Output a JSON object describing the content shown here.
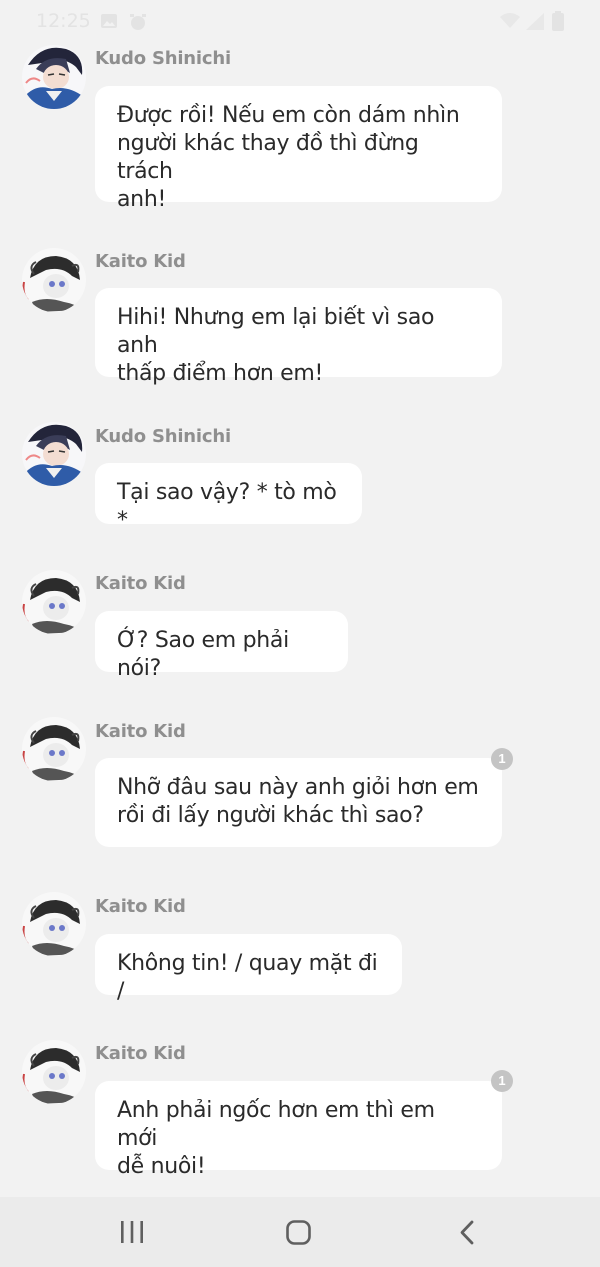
{
  "status_bar": {
    "time": "12:25",
    "icons": [
      "image-icon",
      "alarm-icon",
      "wifi-icon",
      "signal-icon",
      "battery-icon"
    ]
  },
  "messages": [
    {
      "sender": "Kudo Shinichi",
      "avatar": "kudo-avatar",
      "text": "Được rồi! Nếu em còn dám nhìn\nngười khác thay đồ thì đừng trách\nanh!",
      "unread": ""
    },
    {
      "sender": "Kaito Kid",
      "avatar": "kaito-avatar",
      "text": "Hihi! Nhưng em lại biết vì sao anh\nthấp điểm hơn em!",
      "unread": ""
    },
    {
      "sender": "Kudo Shinichi",
      "avatar": "kudo-avatar",
      "text": "Tại sao vậy? * tò mò *",
      "unread": ""
    },
    {
      "sender": "Kaito Kid",
      "avatar": "kaito-avatar",
      "text": "Ớ? Sao em phải nói?",
      "unread": ""
    },
    {
      "sender": "Kaito Kid",
      "avatar": "kaito-avatar",
      "text": "Nhỡ đâu sau này anh giỏi hơn em\nrồi đi lấy người khác thì sao?",
      "unread": "1"
    },
    {
      "sender": "Kaito Kid",
      "avatar": "kaito-avatar",
      "text": "Không tin! / quay mặt đi /",
      "unread": ""
    },
    {
      "sender": "Kaito Kid",
      "avatar": "kaito-avatar",
      "text": "Anh phải ngốc hơn em thì em mới\ndễ nuôi!",
      "unread": "1"
    }
  ],
  "nav_bar": {
    "buttons": [
      "recent-apps-icon",
      "home-icon",
      "back-icon"
    ]
  },
  "colors": {
    "background": "#f2f2f2",
    "bubble": "#ffffff",
    "sender_text": "#8f8f8f",
    "unread_badge": "#c4c4c4",
    "nav_bar": "#ebebeb"
  }
}
